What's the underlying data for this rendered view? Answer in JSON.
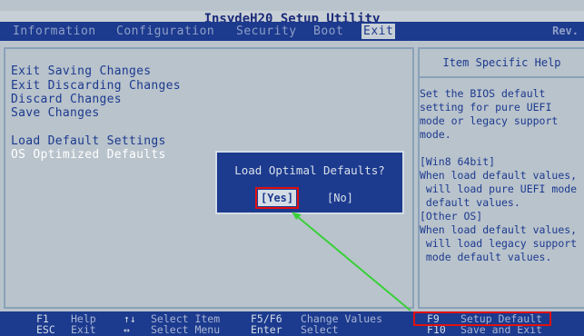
{
  "title": "InsydeH20 Setup Utility",
  "rev": "Rev.",
  "tabs": [
    {
      "label": "Information"
    },
    {
      "label": "Configuration"
    },
    {
      "label": "Security"
    },
    {
      "label": "Boot"
    },
    {
      "label": "Exit",
      "active": true
    }
  ],
  "menu": [
    "Exit Saving Changes",
    "Exit Discarding Changes",
    "Discard Changes",
    "Save Changes",
    "Load Default Settings",
    "OS Optimized Defaults"
  ],
  "help": {
    "title": "Item Specific Help",
    "body": "Set the BIOS default\nsetting for pure UEFI\nmode or legacy support\nmode.\n\n[Win8 64bit]\nWhen load default values,\n will load pure UEFI mode\n default values.\n[Other OS]\nWhen load default values,\n will load legacy support\n mode default values."
  },
  "dialog": {
    "title": "Load Optimal Defaults?",
    "yes": "[Yes]",
    "no": "[No]"
  },
  "footer": {
    "keys": [
      {
        "key": "F1",
        "desc": "Help"
      },
      {
        "key": "ESC",
        "desc": "Exit"
      },
      {
        "key": "↑↓",
        "desc": "Select Item"
      },
      {
        "key": "↔",
        "desc": "Select Menu"
      },
      {
        "key": "F5/F6",
        "desc": "Change Values"
      },
      {
        "key": "Enter",
        "desc": "Select"
      },
      {
        "key": "F9",
        "desc": "Setup Default"
      },
      {
        "key": "F10",
        "desc": "Save and Exit"
      }
    ]
  },
  "colors": {
    "blue": "#1c3a8e",
    "grey": "#b9c3cc",
    "highlight_red": "#e01010",
    "arrow_green": "#38d038"
  },
  "icons": [
    "mouse-cursor-icon"
  ]
}
